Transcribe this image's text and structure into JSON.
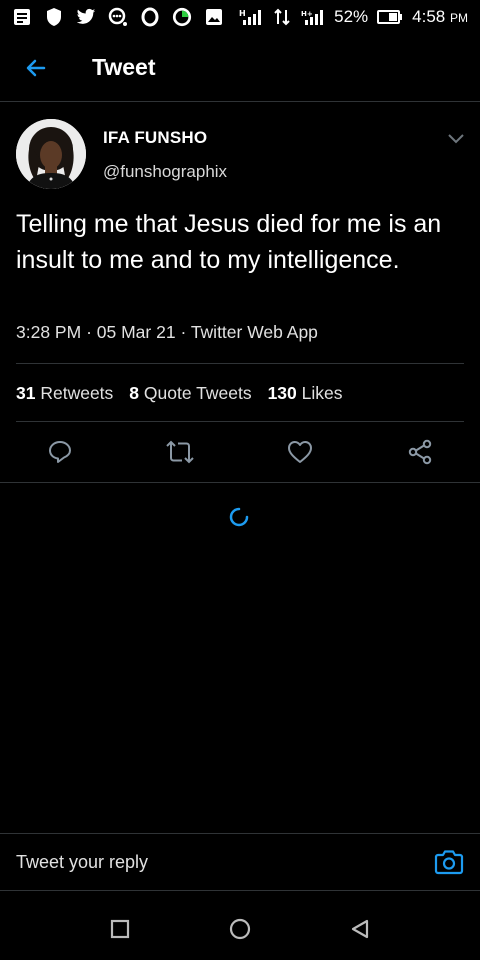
{
  "statusbar": {
    "battery_pct": "52%",
    "time": "4:58",
    "ampm": "PM",
    "network1": "H",
    "network2": "1",
    "network3": "H+"
  },
  "header": {
    "title": "Tweet"
  },
  "tweet": {
    "author_name": "IFA FUNSHO",
    "author_handle": "@funshographix",
    "text": "Telling me that Jesus died for me is an insult to me and to my intelligence.",
    "time": "3:28 PM",
    "date": "05 Mar 21",
    "source": "Twitter Web App",
    "separator": "·"
  },
  "stats": {
    "retweets_count": "31",
    "retweets_label": "Retweets",
    "quotes_count": "8",
    "quotes_label": "Quote Tweets",
    "likes_count": "130",
    "likes_label": "Likes"
  },
  "reply": {
    "placeholder": "Tweet your reply"
  },
  "colors": {
    "accent": "#1d9bf0",
    "background": "#000000",
    "divider": "#2f3336"
  }
}
